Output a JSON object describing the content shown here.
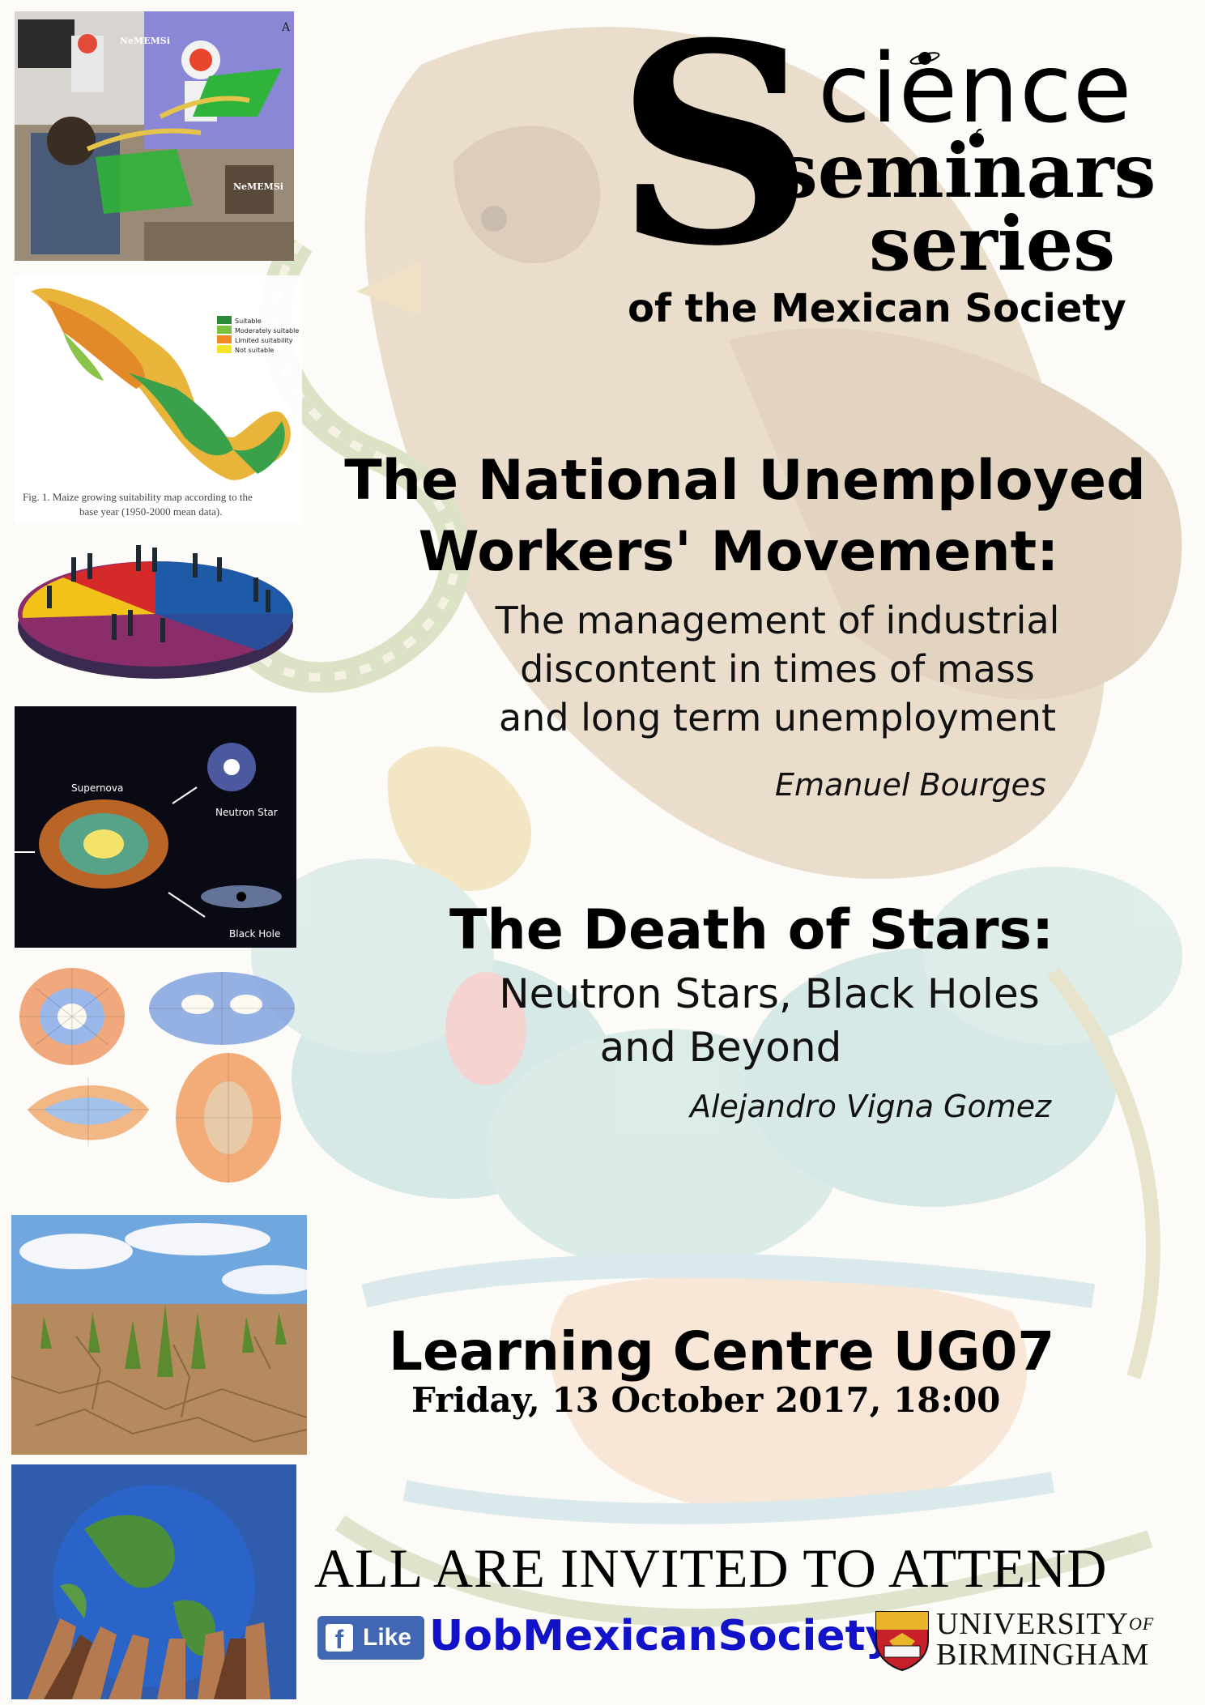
{
  "header": {
    "logo_big_letter": "S",
    "logo_word_1": "cience",
    "logo_word_2": "seminars",
    "logo_word_3": "series",
    "logo_subtitle": "of the Mexican Society"
  },
  "talks": [
    {
      "title_lines": [
        "The National Unemployed",
        "Workers' Movement:"
      ],
      "subtitle_lines": [
        "The management of industrial",
        "discontent in times of mass",
        "and long term unemployment"
      ],
      "speaker": "Emanuel Bourges"
    },
    {
      "title_lines": [
        "The Death of Stars:"
      ],
      "subtitle_lines": [
        "Neutron Stars, Black Holes",
        "and Beyond"
      ],
      "speaker": "Alejandro Vigna Gomez"
    }
  ],
  "event": {
    "venue": "Learning Centre UG07",
    "datetime": "Friday, 13 October 2017, 18:00",
    "invitation": "ALL ARE INVITED TO ATTEND"
  },
  "social": {
    "like_label": "Like",
    "facebook_page": "UobMexicanSociety"
  },
  "university": {
    "line1": "UNIVERSITY",
    "line1_suffix": "OF",
    "line2": "BIRMINGHAM"
  },
  "images": {
    "robot": {
      "label_top": "NeMEMSi",
      "label_bottom": "NeMEMSi",
      "corner_letter": "A"
    },
    "maize_map": {
      "legend": [
        "Suitable",
        "Moderately suitable",
        "Limited suitability",
        "Not suitable"
      ],
      "caption_line1": "Fig. 1. Maize growing suitability map according to the",
      "caption_line2": "base year (1950-2000 mean data)."
    },
    "stars": {
      "label_supernova": "Supernova",
      "label_neutron": "Neutron Star",
      "label_blackhole": "Black Hole"
    }
  },
  "colors": {
    "facebook_blue": "#4267b2",
    "link_blue": "#1212c8",
    "text": "#000000"
  }
}
